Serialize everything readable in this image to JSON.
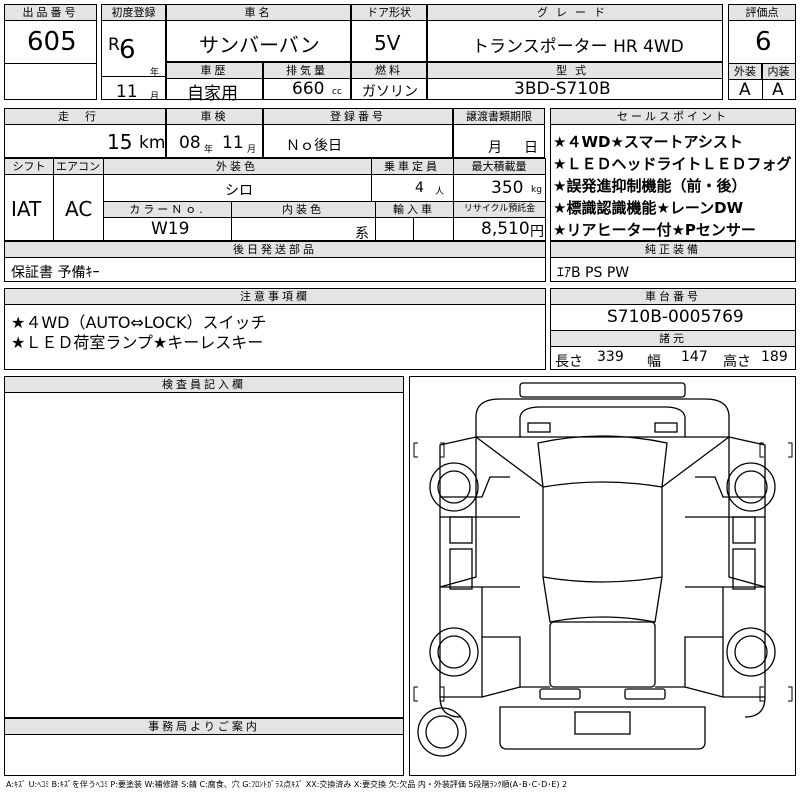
{
  "lot": {
    "label": "出品番号",
    "value": "605"
  },
  "first_reg": {
    "label": "初度登録",
    "era": "R",
    "year": "6",
    "year_unit": "年",
    "month": "11",
    "month_unit": "月"
  },
  "car_name": {
    "label": "車名",
    "value": "サンバーバン"
  },
  "door": {
    "label": "ドア形状",
    "value": "5V"
  },
  "grade": {
    "label": "グレード",
    "value": "トランスポーター HR 4WD"
  },
  "score": {
    "label": "評価点",
    "value": "6"
  },
  "history": {
    "label": "車歴",
    "value": "自家用"
  },
  "displacement": {
    "label": "排気量",
    "value": "660",
    "unit": "cc"
  },
  "fuel": {
    "label": "燃料",
    "value": "ガソリン"
  },
  "model_code": {
    "label": "型式",
    "value": "3BD-S710B"
  },
  "exterior_grade": {
    "label": "外装",
    "value": "A"
  },
  "interior_grade": {
    "label": "内装",
    "value": "A"
  },
  "mileage": {
    "label": "走行",
    "value": "15",
    "unit": "km"
  },
  "inspection": {
    "label": "車検",
    "year": "08",
    "year_unit": "年",
    "month": "11",
    "month_unit": "月"
  },
  "registration_no": {
    "label": "登録番号",
    "value": "Ｎｏ後日"
  },
  "transfer_deadline": {
    "label": "譲渡書類期限",
    "month_unit": "月",
    "day_unit": "日"
  },
  "sales_points": {
    "label": "セールスポイント",
    "items": [
      "★４WD★スマートアシスト",
      "★ＬＥＤヘッドライトＬＥＤフォグ",
      "★誤発進抑制機能（前・後）",
      "★標識認識機能★レーンDW",
      "★リアヒーター付★Pセンサー"
    ]
  },
  "shift": {
    "label": "シフト",
    "value": "IAT"
  },
  "aircon": {
    "label": "エアコン",
    "value": "AC"
  },
  "ext_color": {
    "label": "外装色",
    "value": "シロ"
  },
  "capacity": {
    "label": "乗車定員",
    "value": "4",
    "unit": "人"
  },
  "max_load": {
    "label": "最大積載量",
    "value": "350",
    "unit": "kg"
  },
  "color_no": {
    "label": "カラーＮｏ.",
    "value": "W19"
  },
  "int_color": {
    "label": "内装色",
    "suffix": "系"
  },
  "import": {
    "label": "輸入車"
  },
  "recycle": {
    "label": "リサイクル預託金",
    "value": "8,510",
    "unit": "円"
  },
  "later_parts": {
    "label": "後日発送部品",
    "value": "保証書 予備ｷｰ"
  },
  "equipment": {
    "label": "純正装備",
    "value": "ｴｱB PS PW"
  },
  "notes": {
    "label": "注意事項欄",
    "lines": [
      "★４WD（AUTO⇔LOCK）スイッチ",
      "★ＬＥＤ荷室ランプ★キーレスキー"
    ]
  },
  "chassis": {
    "label": "車台番号",
    "value": "S710B-0005769"
  },
  "dims": {
    "label": "諸元",
    "length_label": "長さ",
    "length": "339",
    "width_label": "幅",
    "width": "147",
    "height_label": "高さ",
    "height": "189"
  },
  "inspector": {
    "label": "検査員記入欄"
  },
  "office": {
    "label": "事務局よりご案内"
  },
  "legend": "A:ｷｽﾞ U:ﾍｺﾐ B:ｷｽﾞを伴うﾍｺﾐ P:要塗装 W:補修跡 S:錆 C:腐食、穴 G:ﾌﾛﾝﾄｶﾞﾗｽ点ｷｽﾞ XX:交換済み X:要交換 欠:欠品 内・外装評価 5段階ﾗﾝｸ順(A･B･C･D･E) 2"
}
